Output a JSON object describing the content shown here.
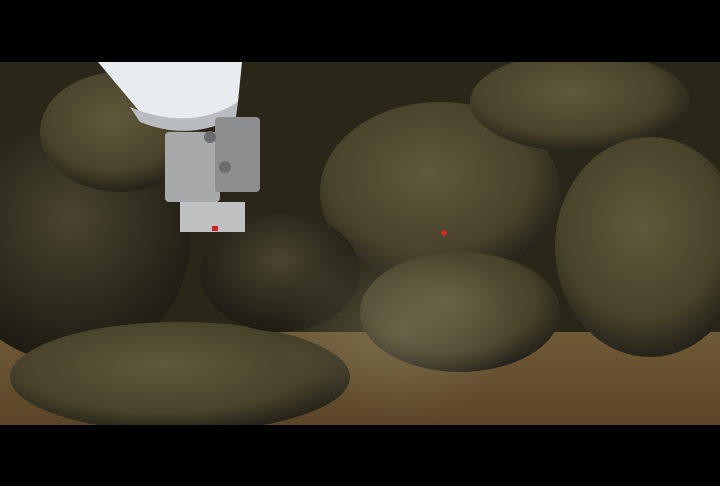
{
  "scene": {
    "subject": "robotic-arm-gripper-over-seafloor-rocks",
    "colors": {
      "letterbox": "#000000",
      "rock": "#4a452c",
      "shadow": "#1f1d12",
      "sediment": "#6b5530",
      "arm": "#e9ecef",
      "laser": "#ff2020"
    }
  }
}
